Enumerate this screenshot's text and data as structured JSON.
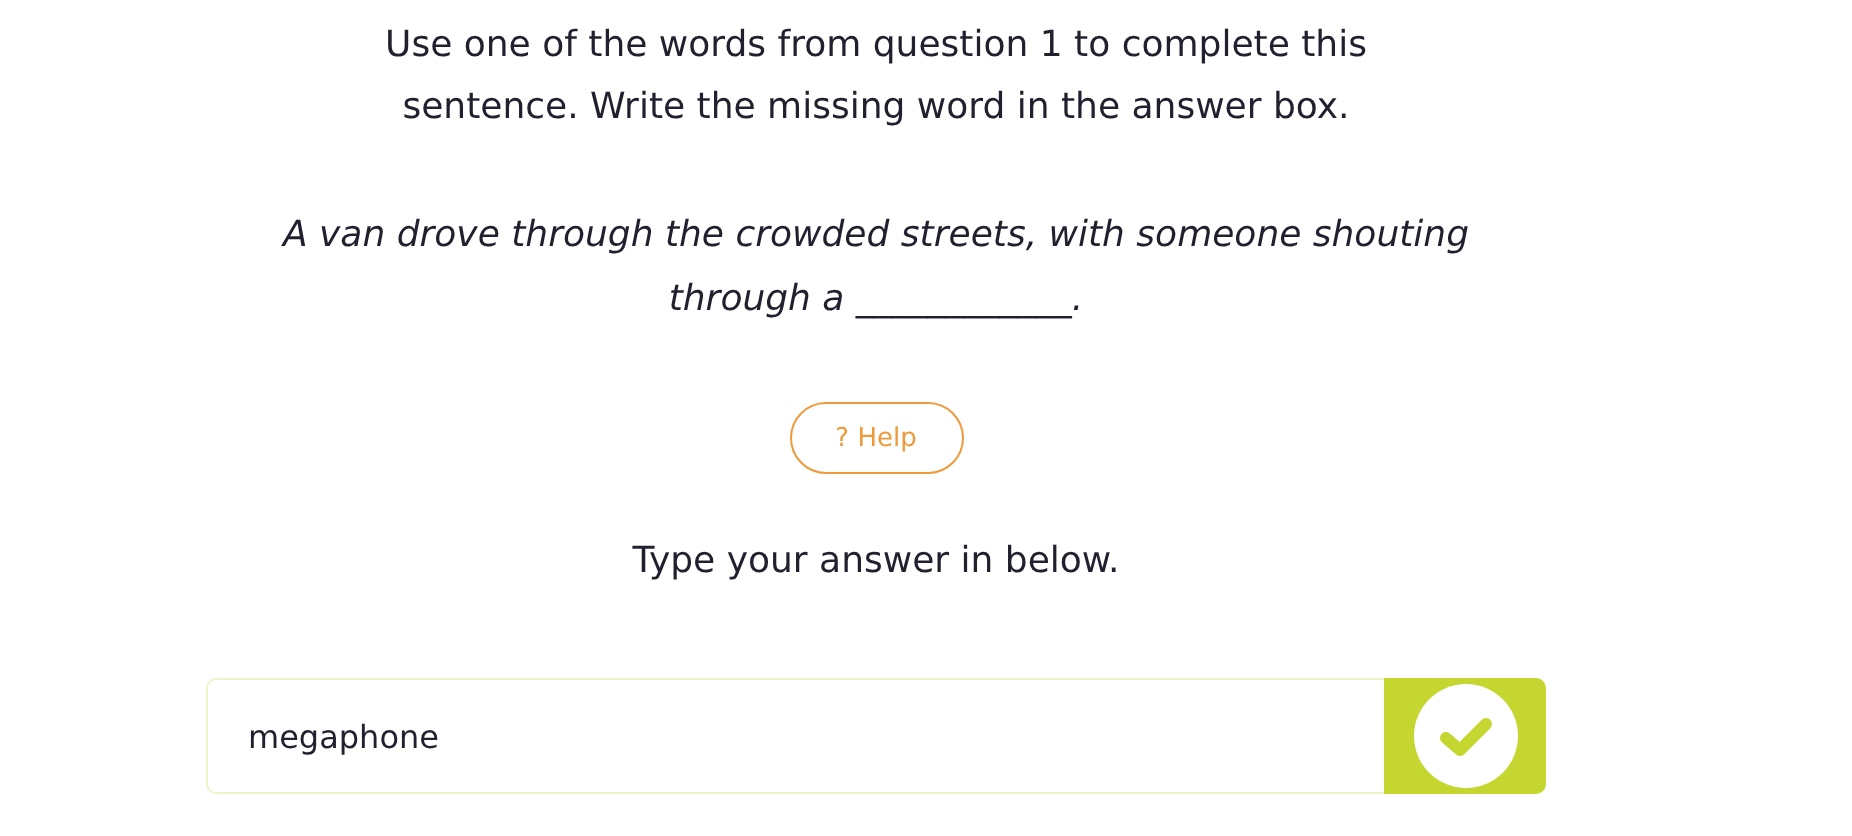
{
  "question": {
    "instruction": "Use one of the words from question 1 to complete this sentence. Write the missing word in the answer box.",
    "sentence": "A van drove through the crowded streets, with someone shouting through a ____________."
  },
  "help_button": {
    "label": "? Help"
  },
  "prompt": "Type your answer in below.",
  "answer": {
    "value": "megaphone"
  }
}
